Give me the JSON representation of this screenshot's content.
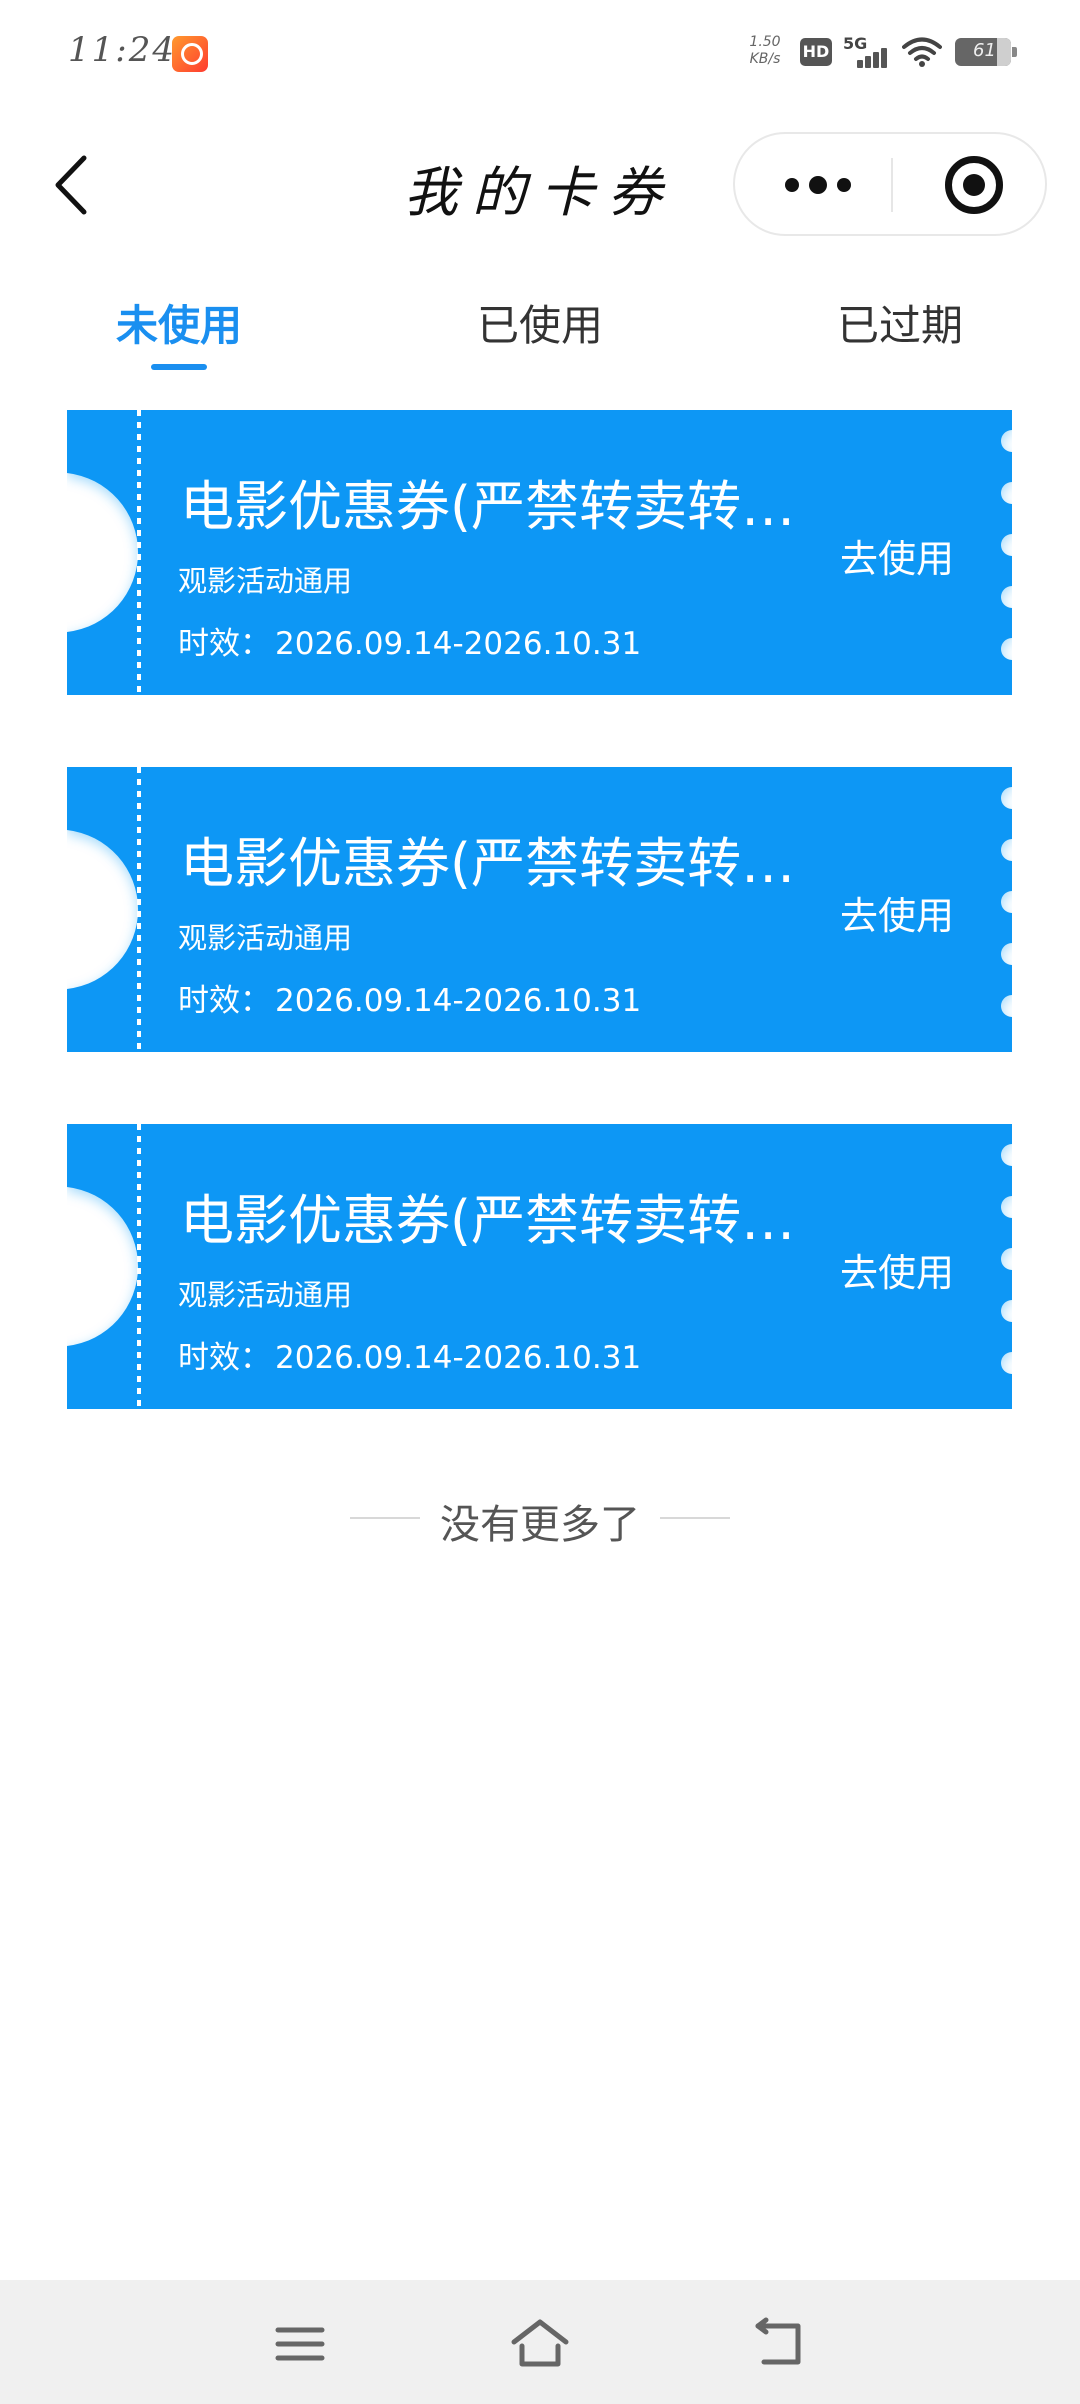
{
  "status_bar": {
    "time": "11:24",
    "net_speed_value": "1.50",
    "net_speed_unit": "KB/s",
    "hd_label": "HD",
    "network_label": "5G",
    "battery_level": "61",
    "icons": [
      "app-badge-icon",
      "hd-icon",
      "signal-icon",
      "wifi-icon",
      "battery-icon"
    ]
  },
  "header": {
    "title": "我的卡券",
    "back_icon": "chevron-left-icon",
    "more_icon": "more-dots-icon",
    "target_icon": "target-icon"
  },
  "tabs": [
    {
      "label": "未使用",
      "active": true
    },
    {
      "label": "已使用",
      "active": false
    },
    {
      "label": "已过期",
      "active": false
    }
  ],
  "coupons": [
    {
      "title": "电影优惠券(严禁转卖转…",
      "subtitle": "观影活动通用",
      "validity_label": "时效：",
      "validity_range": "2026.09.14-2026.10.31",
      "action_label": "去使用"
    },
    {
      "title": "电影优惠券(严禁转卖转…",
      "subtitle": "观影活动通用",
      "validity_label": "时效：",
      "validity_range": "2026.09.14-2026.10.31",
      "action_label": "去使用"
    },
    {
      "title": "电影优惠券(严禁转卖转…",
      "subtitle": "观影活动通用",
      "validity_label": "时效：",
      "validity_range": "2026.09.14-2026.10.31",
      "action_label": "去使用"
    }
  ],
  "end_note": "没有更多了",
  "colors": {
    "accent": "#1a8ff0",
    "coupon_bg": "#0f97f5",
    "page_bg": "#ffffff",
    "system_nav_bg": "#f0f0f0"
  },
  "system_nav": {
    "icons": [
      "menu-icon",
      "home-icon",
      "back-icon"
    ]
  }
}
